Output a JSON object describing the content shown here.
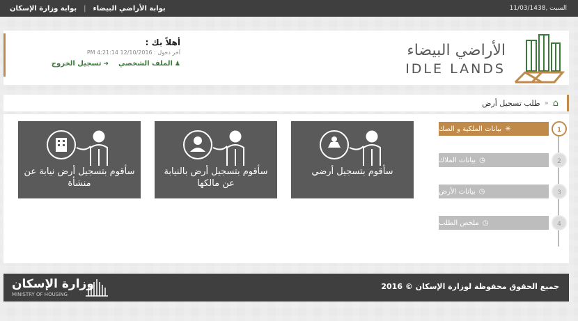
{
  "topbar": {
    "link_ministry": "بوابة وزارة الإسكان",
    "separator": "|",
    "link_idle": "بوابة الأراضي البيضاء",
    "date": "السبت ,11/03/1438"
  },
  "user": {
    "welcome": "أهلاً بك :",
    "last_login": "آخر دخول : 12/10/2016 4:21:14 PM",
    "profile_link": "الملف الشخصي",
    "logout_link": "تسجيل الخروج"
  },
  "logo": {
    "arabic": "الأراضي البيضاء",
    "english": "IDLE LANDS"
  },
  "breadcrumb": {
    "separator": "»",
    "current": "طلب تسجيل أرض"
  },
  "cards": [
    {
      "label": "سأقوم بتسجيل أرضي"
    },
    {
      "label": "سأقوم بتسجيل أرض بالنيابة عن مالكها"
    },
    {
      "label": "سأقوم بتسجيل أرض نيابة عن منشأة"
    }
  ],
  "steps": [
    {
      "num": "1",
      "label": "بيانات الملكية و الصك",
      "active": true
    },
    {
      "num": "2",
      "label": "بيانات الملاك",
      "active": false
    },
    {
      "num": "3",
      "label": "بيانات الأرض",
      "active": false
    },
    {
      "num": "4",
      "label": "ملخص الطلب",
      "active": false
    }
  ],
  "footer": {
    "copyright": "جميع الحقوق محفوظة لوزارة الإسكان © 2016",
    "ministry_ar": "وزارة الإسكان",
    "ministry_en": "MINISTRY OF HOUSING"
  },
  "colors": {
    "accent": "#bf8a4a",
    "green": "#3b7a3a",
    "dark": "#3f3f3f",
    "card": "#5a5a5a"
  }
}
